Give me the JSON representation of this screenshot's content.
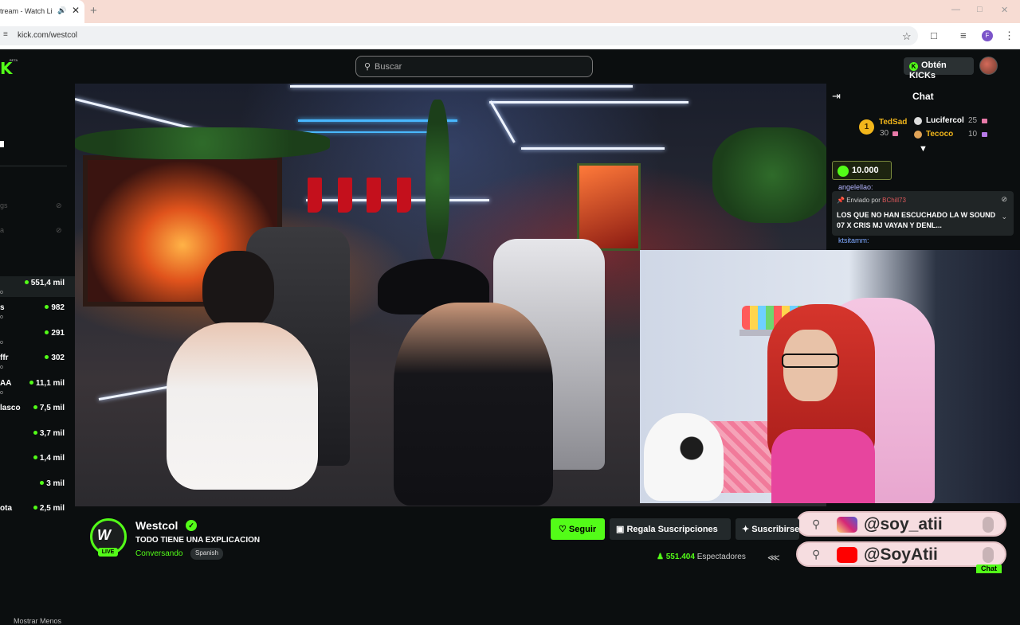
{
  "browser": {
    "tab_title": "tream - Watch Liv",
    "url": "kick.com/westcol",
    "profile_initial": "F",
    "icons": [
      "speaker-icon",
      "close-icon",
      "plus-icon",
      "star-icon",
      "extensions-icon",
      "media-icon",
      "menu-icon"
    ]
  },
  "nav": {
    "search_placeholder": "Buscar",
    "get_kicks_label": "Obtén KICKs",
    "beta_label": "BETA"
  },
  "sidebar": {
    "dim_rows": [
      "gs",
      "a"
    ],
    "channels": [
      {
        "name": "",
        "sub": "o",
        "viewers": "551,4 mil"
      },
      {
        "name": "s",
        "sub": "o",
        "viewers": "982"
      },
      {
        "name": "",
        "sub": "o",
        "viewers": "291"
      },
      {
        "name": "ffr",
        "sub": "o",
        "viewers": "302"
      },
      {
        "name": "AA",
        "sub": "o",
        "viewers": "11,1 mil"
      },
      {
        "name": "lasco",
        "sub": "",
        "viewers": "7,5 mil"
      },
      {
        "name": "",
        "sub": "",
        "viewers": "3,7 mil"
      },
      {
        "name": "",
        "sub": "",
        "viewers": "1,4 mil"
      },
      {
        "name": "",
        "sub": "",
        "viewers": "3 mil"
      },
      {
        "name": "ota",
        "sub": "",
        "viewers": "2,5 mil"
      }
    ],
    "show_less": "Mostrar Menos"
  },
  "chat": {
    "title": "Chat",
    "leaderboard": [
      {
        "rank": "1",
        "name": "TedSad",
        "count": "30",
        "color": "#f2b61b"
      },
      {
        "name": "Lucifercol",
        "count": "25",
        "color": "#ffffff"
      },
      {
        "name": "Tecoco",
        "count": "10",
        "color": "#f2b61b"
      }
    ],
    "kicks_amount": "10.000",
    "line1_user": "angelellao:",
    "pinned": {
      "sent_by": "Enviado por",
      "sender": "BChill73",
      "message": "LOS QUE NO HAN ESCUCHADO LA W SOUND 07 X CRIS MJ VAYAN Y DENL..."
    },
    "line2_user": "ktsitamm:",
    "bottom_button": "Chat"
  },
  "overlay": {
    "instagram": "@soy_atii",
    "youtube": "@SoyAtii",
    "instagram_color": "#d6249f",
    "youtube_color": "#ff0000"
  },
  "stream": {
    "streamer": "Westcol",
    "title": "TODO TIENE UNA EXPLICACION",
    "category": "Conversando",
    "language": "Spanish",
    "live_badge": "LIVE",
    "follow_label": "Seguir",
    "gift_label": "Regala Suscripciones",
    "subscribe_label": "Suscribirse",
    "viewer_count": "551.404",
    "viewer_label": "Espectadores",
    "accent": "#53fc18"
  }
}
